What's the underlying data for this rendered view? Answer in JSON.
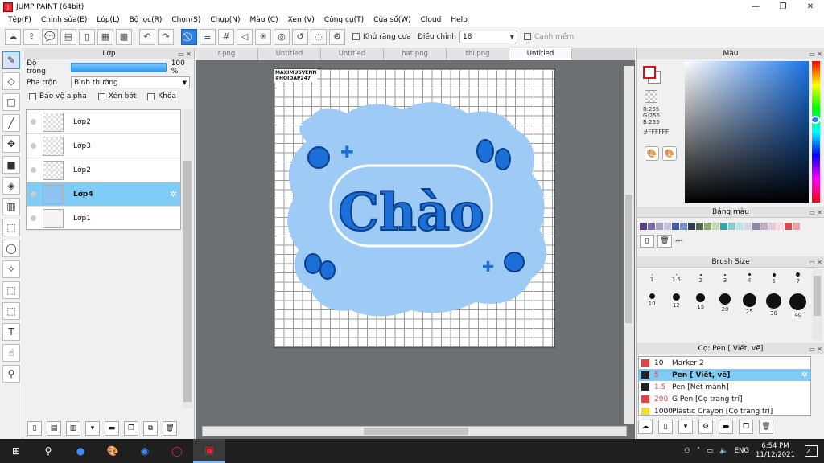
{
  "window": {
    "title": "JUMP PAINT (64bit)",
    "minimize_icon": "minimize-icon",
    "maximize_icon": "restore-icon",
    "close_icon": "close-icon"
  },
  "menu": [
    "Tệp(F)",
    "Chỉnh sửa(E)",
    "Lớp(L)",
    "Bộ lọc(R)",
    "Chọn(S)",
    "Chụp(N)",
    "Màu (C)",
    "Xem(V)",
    "Công cụ(T)",
    "Cửa sổ(W)",
    "Cloud",
    "Help"
  ],
  "toolbar": {
    "antialias_label": "Khử răng cưa",
    "adjust_label": "Điều chỉnh",
    "adjust_value": "18",
    "snap_label": "Cạnh mềm"
  },
  "layer_panel": {
    "title": "Lớp",
    "opacity_label": "Độ trong",
    "opacity_value": "100 %",
    "blend_label": "Pha trộn",
    "blend_value": "Bình thường",
    "protect_alpha": "Bảo vệ alpha",
    "clipping": "Xén bớt",
    "lock": "Khóa",
    "layers": [
      {
        "name": "Lớp2",
        "active": false
      },
      {
        "name": "Lớp3",
        "active": false
      },
      {
        "name": "Lớp2",
        "active": false
      },
      {
        "name": "Lớp4",
        "active": true
      },
      {
        "name": "Lớp1",
        "active": false
      }
    ]
  },
  "tabs": [
    {
      "label": "r.png",
      "active": false
    },
    {
      "label": "Untitled",
      "active": false
    },
    {
      "label": "Untitled",
      "active": false
    },
    {
      "label": "hat.png",
      "active": false
    },
    {
      "label": "thi.png",
      "active": false
    },
    {
      "label": "Untitled",
      "active": true
    }
  ],
  "canvas": {
    "watermark_line1": "MAXIMUSVENN",
    "watermark_line2": "#HOIDAP247",
    "artwork_text": "Chào"
  },
  "color_panel": {
    "title": "Màu",
    "r": "R:255",
    "g": "G:255",
    "b": "B:255",
    "hex": "#FFFFFF",
    "fg_color": "#FFFFFF",
    "accent": "#1A73E8"
  },
  "palette": {
    "title": "Bảng màu",
    "dash": "---",
    "colors": [
      "#5b3b8a",
      "#7a6aa8",
      "#a89fc6",
      "#c9c2de",
      "#3a5fa8",
      "#6f8fcf",
      "#2c3e50",
      "#4a6a4a",
      "#88aa66",
      "#c8d8a8",
      "#2aa8a8",
      "#7fd0d0",
      "#b8e8e8",
      "#d8d8e8",
      "#8888aa",
      "#c8a8c8",
      "#e8c8d8",
      "#f8d8d8",
      "#e04848",
      "#f0a0a0"
    ]
  },
  "brush_size": {
    "title": "Brush Size",
    "sizes": [
      [
        ".",
        "1"
      ],
      [
        ".",
        "1.5"
      ],
      [
        ".",
        "2"
      ],
      [
        ".",
        "3"
      ],
      [
        ".",
        "4"
      ],
      [
        ".",
        "5"
      ],
      [
        ".",
        "7"
      ]
    ],
    "row1": [
      "1",
      "1.5",
      "2",
      "3",
      "4",
      "5",
      "7"
    ],
    "row2": [
      "10",
      "12",
      "15",
      "20",
      "25",
      "30",
      "40"
    ]
  },
  "brush_list": {
    "title": "Cọ: Pen [ Viết, vẽ]",
    "items": [
      {
        "size": "10",
        "name": "Marker 2",
        "color": "#e84040",
        "active": false
      },
      {
        "size": "5",
        "name": "Pen [ Viết, vẽ]",
        "color": "#222222",
        "active": true
      },
      {
        "size": "1.5",
        "name": "Pen [Nét mảnh]",
        "color": "#222222",
        "active": false
      },
      {
        "size": "200",
        "name": "G Pen [Cọ trang trí]",
        "color": "#e84040",
        "active": false
      },
      {
        "size": "1000",
        "name": "Plastic Crayon [Cọ trang trí]",
        "color": "#f0e020",
        "active": false
      }
    ]
  },
  "taskbar": {
    "lang": "ENG",
    "time": "6:54 PM",
    "date": "11/12/2021",
    "notif_count": "2"
  }
}
